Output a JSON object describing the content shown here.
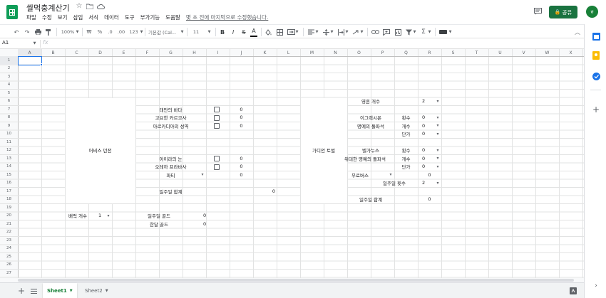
{
  "doc": {
    "title": "쌀먹충계산기",
    "last_edit": "몇 초 전에 마지막으로 수정했습니다."
  },
  "menus": [
    "파일",
    "수정",
    "보기",
    "삽입",
    "서식",
    "데이터",
    "도구",
    "부가기능",
    "도움말"
  ],
  "share_label": "공유",
  "avatar_initial": "ㅎ",
  "toolbar": {
    "zoom": "100%",
    "currency": "₩",
    "percent": "%",
    "dec_less": ".0",
    "dec_more": ".00",
    "format": "123",
    "font": "기본값 (Cal...",
    "font_size": "11",
    "bold": "B",
    "italic": "I",
    "strike": "S",
    "textcolor": "A"
  },
  "name_box": "A1",
  "fx_label": "fx",
  "columns": [
    "A",
    "B",
    "C",
    "D",
    "E",
    "F",
    "G",
    "H",
    "I",
    "J",
    "K",
    "L",
    "M",
    "N",
    "O",
    "P",
    "Q",
    "R",
    "S",
    "T",
    "U",
    "V",
    "W",
    "X"
  ],
  "rows": [
    "1",
    "2",
    "3",
    "4",
    "5",
    "6",
    "7",
    "8",
    "9",
    "10",
    "11",
    "12",
    "13",
    "14",
    "15",
    "16",
    "17",
    "18",
    "19",
    "20",
    "21",
    "22",
    "23",
    "24",
    "25",
    "26",
    "27"
  ],
  "abyss": {
    "title": "어비스 던전",
    "items": [
      {
        "label": "태만의 바다",
        "value": "0",
        "checked": false
      },
      {
        "label": "고요한 카르코사",
        "value": "0",
        "checked": false
      },
      {
        "label": "아르카디아의 성역",
        "value": "0",
        "checked": false
      },
      {
        "label": "아이라의 눈",
        "value": "0",
        "checked": false
      },
      {
        "label": "오레하 프라바사",
        "value": "0",
        "checked": false
      }
    ],
    "party_label": "파티",
    "party_value": "0",
    "weekly_total_label": "일주일 합계",
    "weekly_total_value": "0"
  },
  "character": {
    "label": "배럭 개수",
    "value": "1"
  },
  "gold": {
    "weekly_label": "일주일 골드",
    "weekly_value": "0",
    "monthly_label": "한달 골드",
    "monthly_value": "0"
  },
  "guardian": {
    "title": "가디언 토벌",
    "souls_label": "영혼 개수",
    "souls_value": "2",
    "b1_name": "이그렉시온",
    "b1_sub": "명예의 돌파석",
    "b1_rows": [
      {
        "k": "횟수",
        "v": "0"
      },
      {
        "k": "개수",
        "v": "0"
      },
      {
        "k": "단가",
        "v": "0"
      }
    ],
    "b2_name": "벨가누스",
    "b2_sub": "위대한 명예의 돌파석",
    "b2_rows": [
      {
        "k": "횟수",
        "v": "0"
      },
      {
        "k": "개수",
        "v": "0"
      },
      {
        "k": "단가",
        "v": "0"
      }
    ],
    "free_label": "무료버스",
    "free_value": "0",
    "weekly_count_label": "일주일 횟수",
    "weekly_count_value": "2",
    "weekly_total_label": "일주일 합계",
    "weekly_total_value": "0"
  },
  "sheets": [
    "Sheet1",
    "Sheet2"
  ]
}
